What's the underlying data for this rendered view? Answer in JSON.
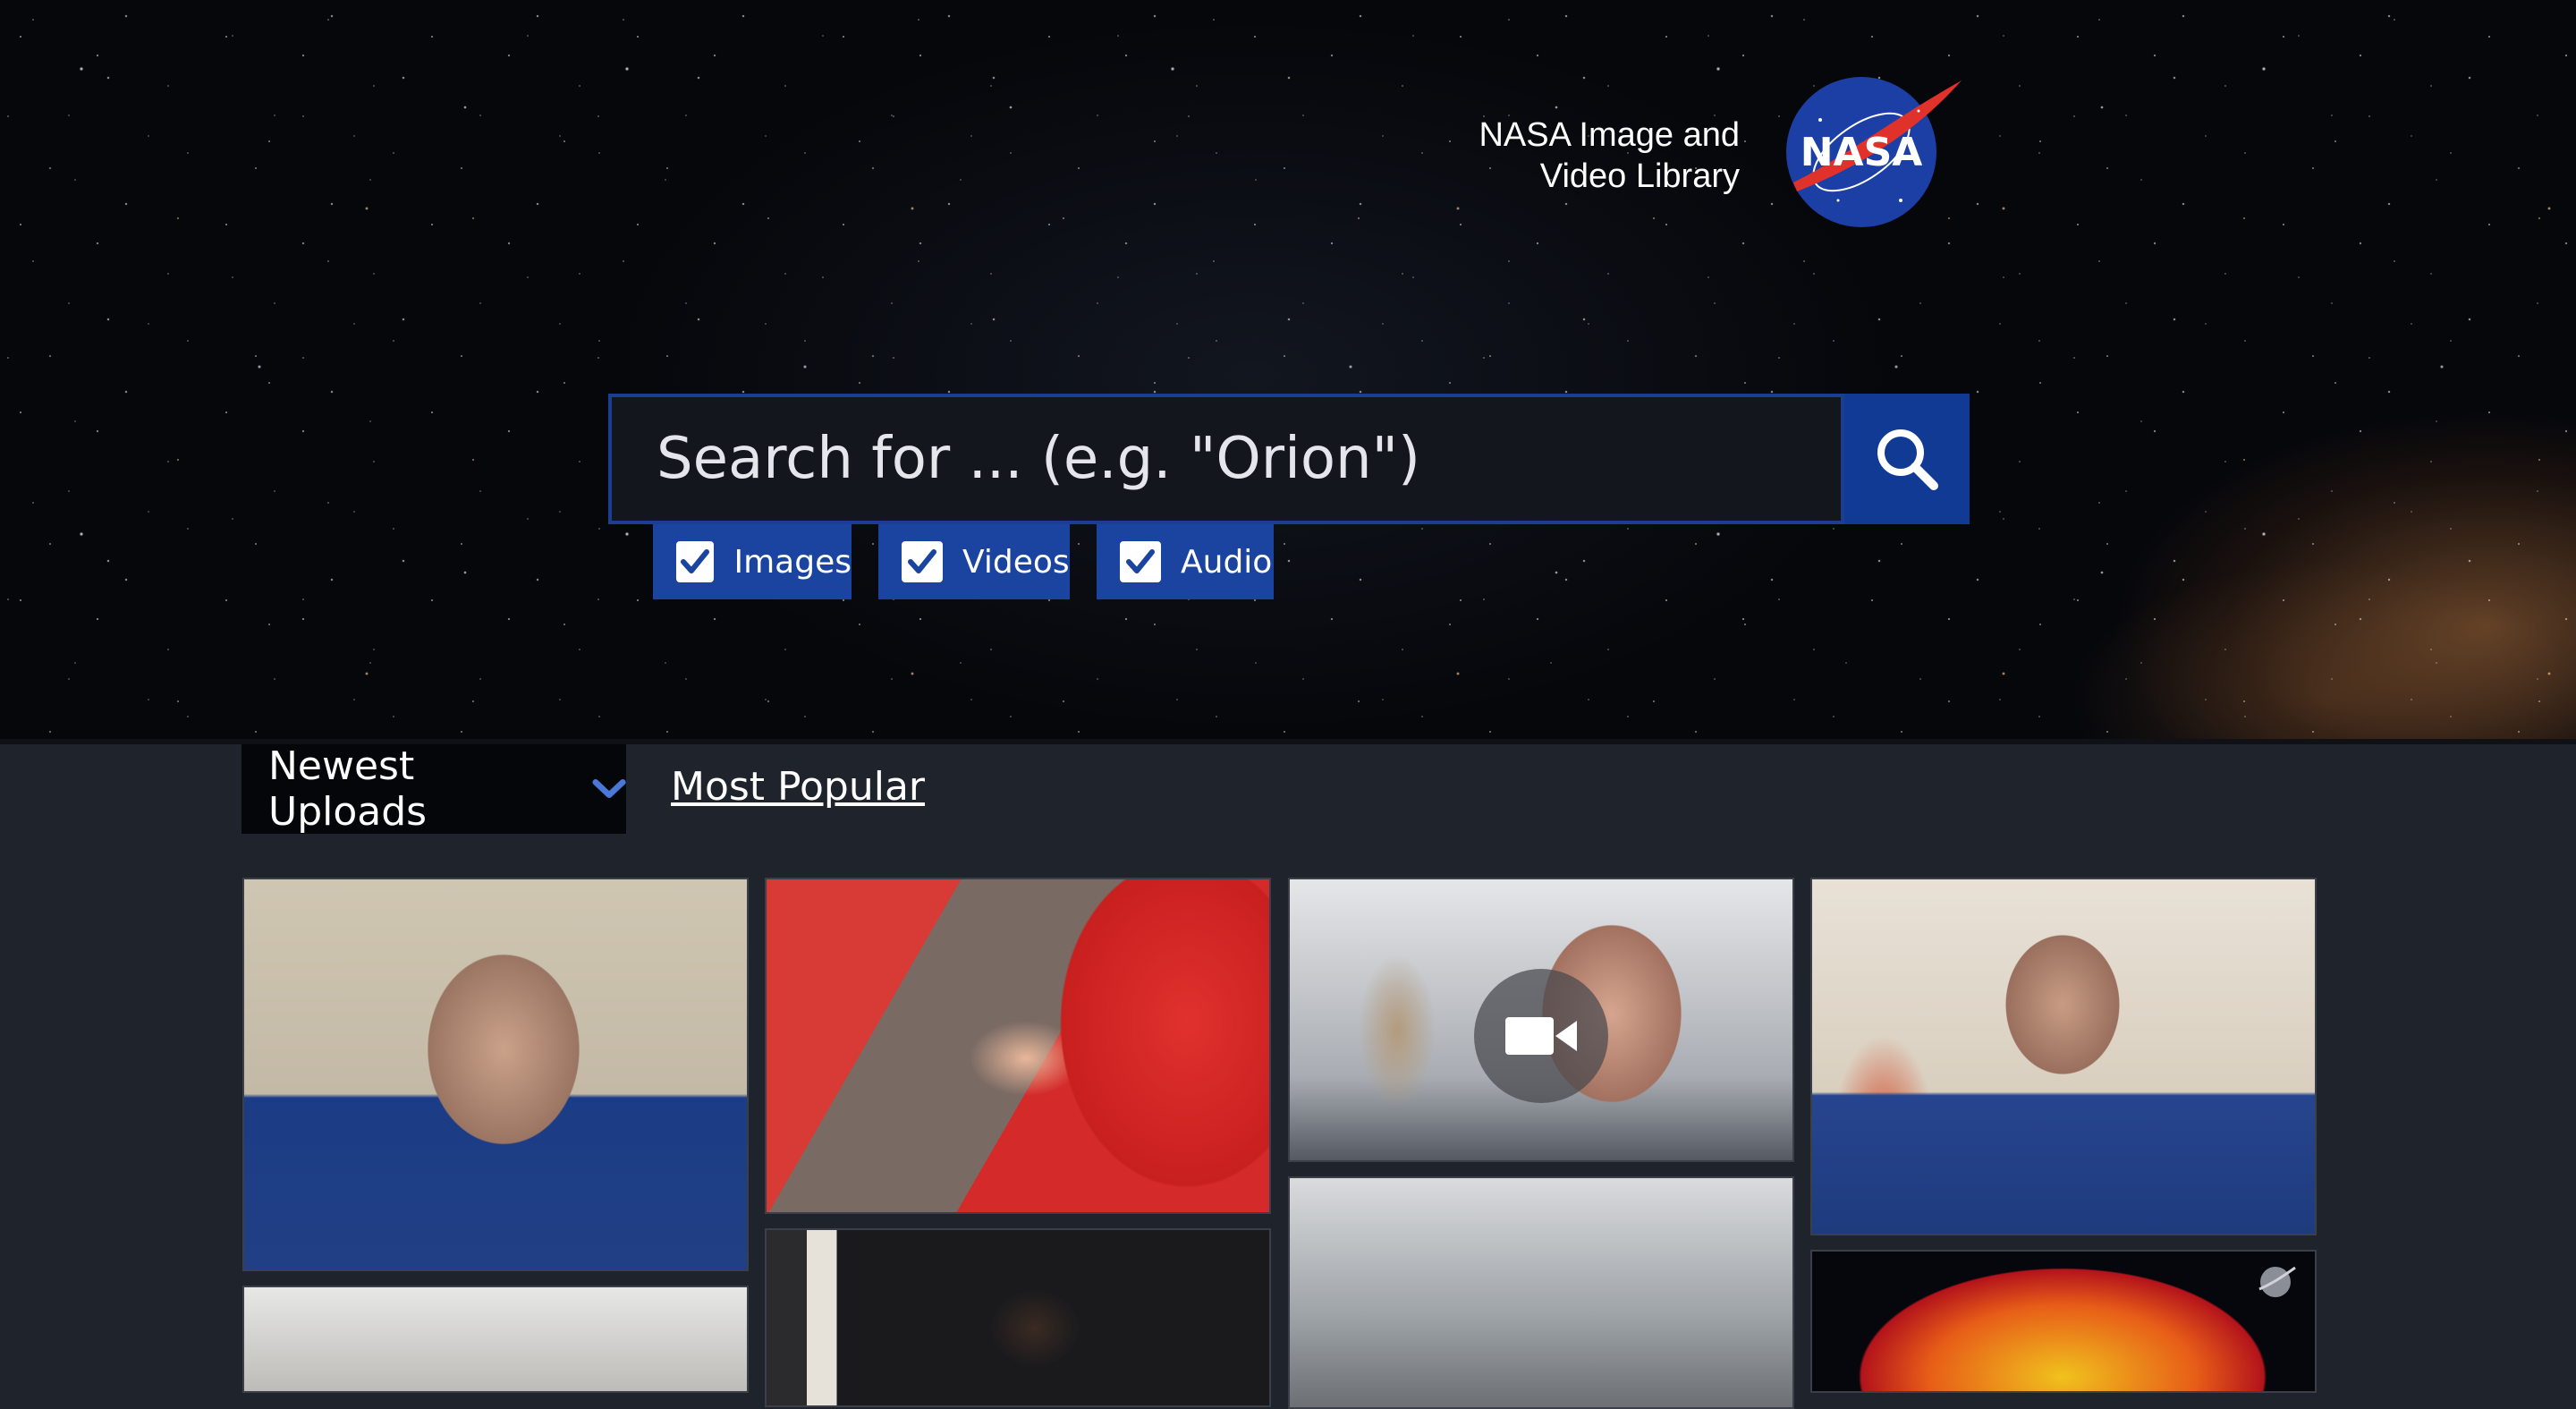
{
  "header": {
    "logo_line1": "NASA Image and",
    "logo_line2": "Video Library",
    "logo_badge": "NASA"
  },
  "search": {
    "placeholder": "Search for ... (e.g. \"Orion\")",
    "value": "",
    "button_icon": "search-icon"
  },
  "filters": [
    {
      "label": "Images",
      "checked": true
    },
    {
      "label": "Videos",
      "checked": true
    },
    {
      "label": "Audio",
      "checked": true
    }
  ],
  "tabs": {
    "active_label": "Newest Uploads",
    "active_icon": "chevron-down-icon",
    "other_label": "Most Popular"
  },
  "gallery": {
    "items": [
      {
        "type": "image"
      },
      {
        "type": "image"
      },
      {
        "type": "video",
        "badge_icon": "video-camera-icon"
      },
      {
        "type": "image"
      },
      {
        "type": "image"
      },
      {
        "type": "image"
      },
      {
        "type": "image"
      },
      {
        "type": "image",
        "badge_icon": "nasa-meatball-icon"
      }
    ]
  },
  "colors": {
    "accent_blue": "#113a94",
    "filter_blue": "#1a449f",
    "page_background": "#1f232c",
    "tab_active_background": "#05060a"
  }
}
